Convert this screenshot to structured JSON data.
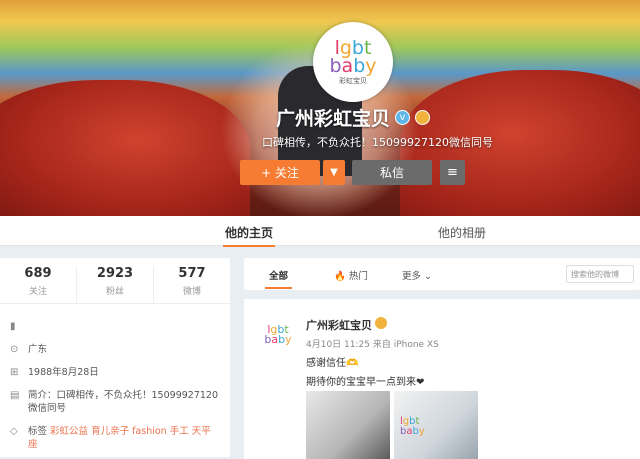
{
  "profile": {
    "name": "广州彩虹宝贝",
    "intro": "口碑相传，不负众托！15099927120微信同号",
    "logo_line1": [
      "l",
      "g",
      "b",
      "t"
    ],
    "logo_line2": [
      "b",
      "a",
      "b",
      "y"
    ],
    "logo_cn": "彩虹宝贝",
    "follow_label": "+ 关注",
    "message_label": "私信",
    "verified_icon": "v"
  },
  "tabs": {
    "home": "他的主页",
    "album": "他的相册"
  },
  "stats": [
    {
      "num": "689",
      "label": "关注"
    },
    {
      "num": "2923",
      "label": "粉丝"
    },
    {
      "num": "577",
      "label": "微博"
    }
  ],
  "info": {
    "location": "广东",
    "birthday": "1988年8月28日",
    "bio_label": "简介：",
    "bio": "口碑相传，不负众托！15099927120微信同号",
    "tags_label": "标签",
    "tags": "彩虹公益 育儿亲子 fashion 手工 天平座"
  },
  "feed": {
    "all": "全部",
    "hot": "热门",
    "more": "更多",
    "search_placeholder": "搜索他的微博"
  },
  "post": {
    "name": "广州彩虹宝贝",
    "time": "4月10日 11:25 来自 iPhone XS",
    "text1": "感谢信任🫶",
    "text2": "期待你的宝宝早一点到来❤"
  },
  "colors": {
    "accent": "#f77c33",
    "message_button": "#6b6b6b",
    "tag_link": "#eb7350"
  }
}
